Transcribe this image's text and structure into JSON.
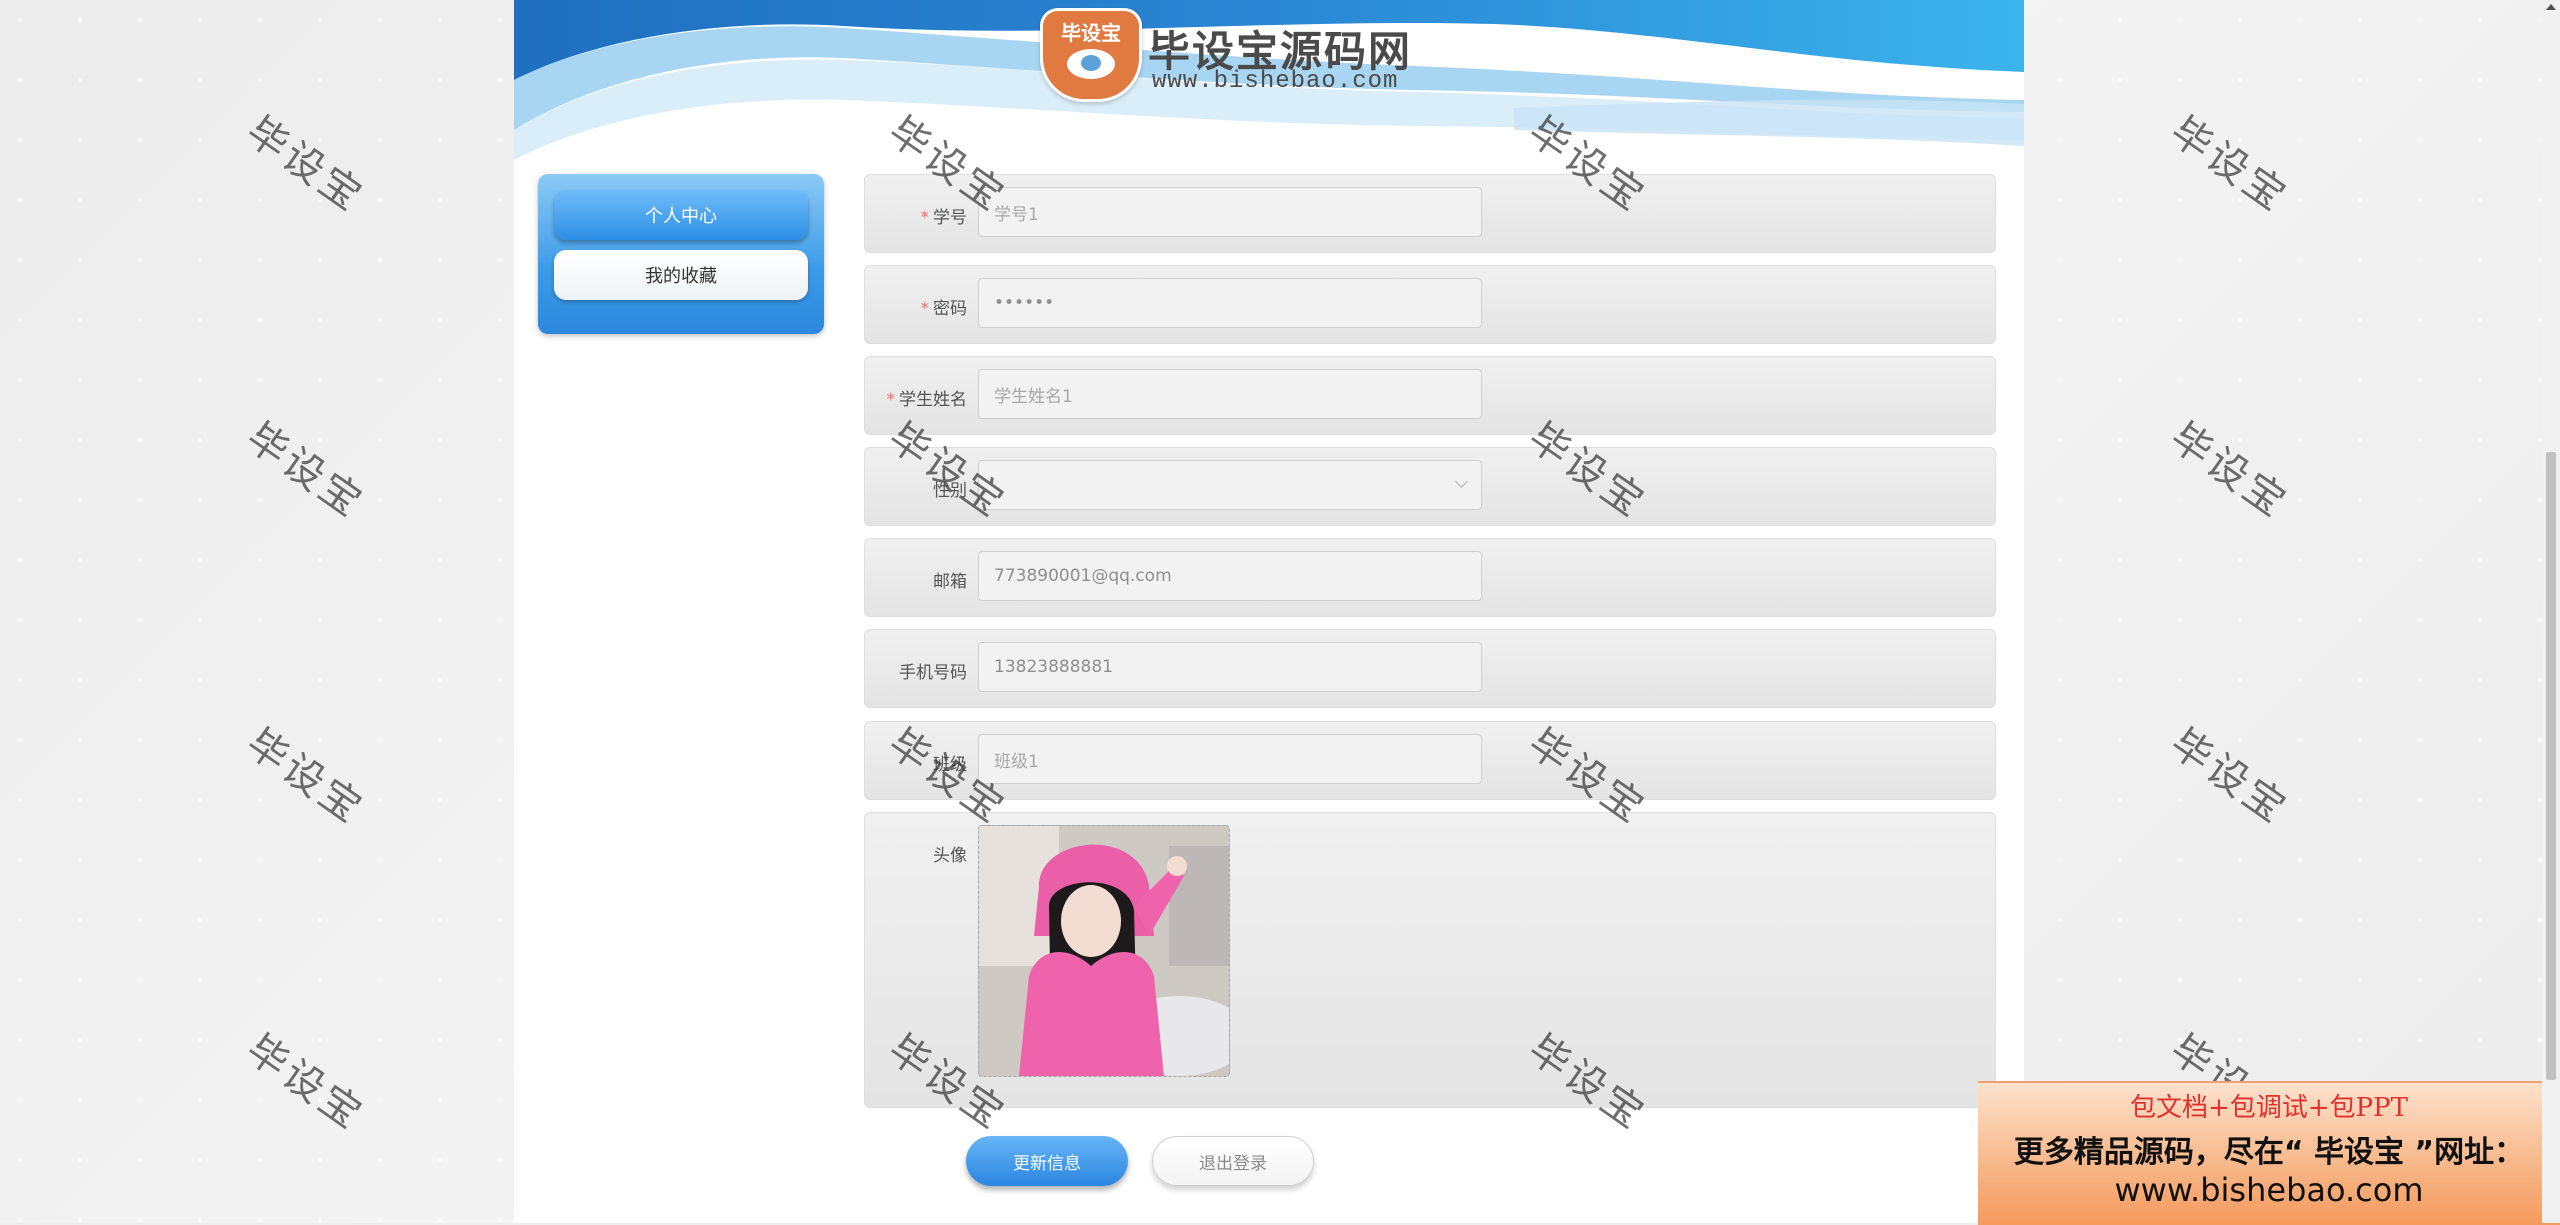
{
  "logo": {
    "badge_text": "毕设宝",
    "title": "毕设宝源码网",
    "url": "www.bishebao.com"
  },
  "sidebar": {
    "items": [
      {
        "label": "个人中心",
        "active": true
      },
      {
        "label": "我的收藏",
        "active": false
      }
    ]
  },
  "form": {
    "student_no": {
      "label": "学号",
      "required": true,
      "value": "学号1"
    },
    "password": {
      "label": "密码",
      "required": true,
      "value": "••••••"
    },
    "student_name": {
      "label": "学生姓名",
      "required": true,
      "value": "学生姓名1"
    },
    "gender": {
      "label": "性别",
      "required": false,
      "value": ""
    },
    "email": {
      "label": "邮箱",
      "required": false,
      "value": "773890001@qq.com"
    },
    "phone": {
      "label": "手机号码",
      "required": false,
      "value": "13823888881"
    },
    "class": {
      "label": "班级",
      "required": false,
      "value": "班级1"
    },
    "avatar": {
      "label": "头像"
    },
    "required_mark": "*"
  },
  "actions": {
    "update_label": "更新信息",
    "logout_label": "退出登录"
  },
  "watermark_text": "毕设宝",
  "promo": {
    "line1": "包文档+包调试+包PPT",
    "line2": "更多精品源码，尽在“ 毕设宝 ”网址：",
    "line3": "www.bishebao.com"
  },
  "colors": {
    "accent": "#2e8fe6",
    "required": "#f56c6c",
    "promo_red": "#e03030"
  }
}
